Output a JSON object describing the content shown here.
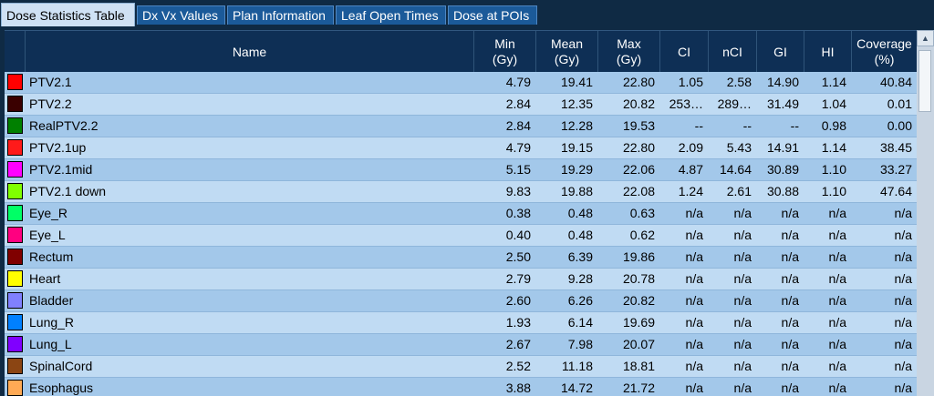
{
  "tabs": [
    {
      "label": "Dose Statistics Table",
      "active": true
    },
    {
      "label": "Dx Vx Values"
    },
    {
      "label": "Plan Information"
    },
    {
      "label": "Leaf Open Times"
    },
    {
      "label": "Dose at POIs"
    }
  ],
  "columns": {
    "name": "Name",
    "min": "Min\n(Gy)",
    "mean": "Mean\n(Gy)",
    "max": "Max\n(Gy)",
    "ci": "CI",
    "nci": "nCI",
    "gi": "GI",
    "hi": "HI",
    "coverage": "Coverage\n(%)"
  },
  "rows": [
    {
      "color": "#ff0000",
      "name": "PTV2.1",
      "min": "4.79",
      "mean": "19.41",
      "max": "22.80",
      "ci": "1.05",
      "nci": "2.58",
      "gi": "14.90",
      "hi": "1.14",
      "coverage": "40.84"
    },
    {
      "color": "#3a0000",
      "name": "PTV2.2",
      "min": "2.84",
      "mean": "12.35",
      "max": "20.82",
      "ci": "253…",
      "nci": "289…",
      "gi": "31.49",
      "hi": "1.04",
      "coverage": "0.01"
    },
    {
      "color": "#008000",
      "name": "RealPTV2.2",
      "min": "2.84",
      "mean": "12.28",
      "max": "19.53",
      "ci": "--",
      "nci": "--",
      "gi": "--",
      "hi": "0.98",
      "coverage": "0.00"
    },
    {
      "color": "#ff1a1a",
      "name": "PTV2.1up",
      "min": "4.79",
      "mean": "19.15",
      "max": "22.80",
      "ci": "2.09",
      "nci": "5.43",
      "gi": "14.91",
      "hi": "1.14",
      "coverage": "38.45"
    },
    {
      "color": "#ff00ff",
      "name": "PTV2.1mid",
      "min": "5.15",
      "mean": "19.29",
      "max": "22.06",
      "ci": "4.87",
      "nci": "14.64",
      "gi": "30.89",
      "hi": "1.10",
      "coverage": "33.27"
    },
    {
      "color": "#80ff00",
      "name": "PTV2.1 down",
      "min": "9.83",
      "mean": "19.88",
      "max": "22.08",
      "ci": "1.24",
      "nci": "2.61",
      "gi": "30.88",
      "hi": "1.10",
      "coverage": "47.64"
    },
    {
      "color": "#00ff66",
      "name": "Eye_R",
      "min": "0.38",
      "mean": "0.48",
      "max": "0.63",
      "ci": "n/a",
      "nci": "n/a",
      "gi": "n/a",
      "hi": "n/a",
      "coverage": "n/a"
    },
    {
      "color": "#ff0080",
      "name": "Eye_L",
      "min": "0.40",
      "mean": "0.48",
      "max": "0.62",
      "ci": "n/a",
      "nci": "n/a",
      "gi": "n/a",
      "hi": "n/a",
      "coverage": "n/a"
    },
    {
      "color": "#800000",
      "name": "Rectum",
      "min": "2.50",
      "mean": "6.39",
      "max": "19.86",
      "ci": "n/a",
      "nci": "n/a",
      "gi": "n/a",
      "hi": "n/a",
      "coverage": "n/a"
    },
    {
      "color": "#ffff00",
      "name": "Heart",
      "min": "2.79",
      "mean": "9.28",
      "max": "20.78",
      "ci": "n/a",
      "nci": "n/a",
      "gi": "n/a",
      "hi": "n/a",
      "coverage": "n/a"
    },
    {
      "color": "#8080ff",
      "name": "Bladder",
      "min": "2.60",
      "mean": "6.26",
      "max": "20.82",
      "ci": "n/a",
      "nci": "n/a",
      "gi": "n/a",
      "hi": "n/a",
      "coverage": "n/a"
    },
    {
      "color": "#0080ff",
      "name": "Lung_R",
      "min": "1.93",
      "mean": "6.14",
      "max": "19.69",
      "ci": "n/a",
      "nci": "n/a",
      "gi": "n/a",
      "hi": "n/a",
      "coverage": "n/a"
    },
    {
      "color": "#8000ff",
      "name": "Lung_L",
      "min": "2.67",
      "mean": "7.98",
      "max": "20.07",
      "ci": "n/a",
      "nci": "n/a",
      "gi": "n/a",
      "hi": "n/a",
      "coverage": "n/a"
    },
    {
      "color": "#8b4513",
      "name": "SpinalCord",
      "min": "2.52",
      "mean": "11.18",
      "max": "18.81",
      "ci": "n/a",
      "nci": "n/a",
      "gi": "n/a",
      "hi": "n/a",
      "coverage": "n/a"
    },
    {
      "color": "#ffaa55",
      "name": "Esophagus",
      "min": "3.88",
      "mean": "14.72",
      "max": "21.72",
      "ci": "n/a",
      "nci": "n/a",
      "gi": "n/a",
      "hi": "n/a",
      "coverage": "n/a"
    }
  ]
}
